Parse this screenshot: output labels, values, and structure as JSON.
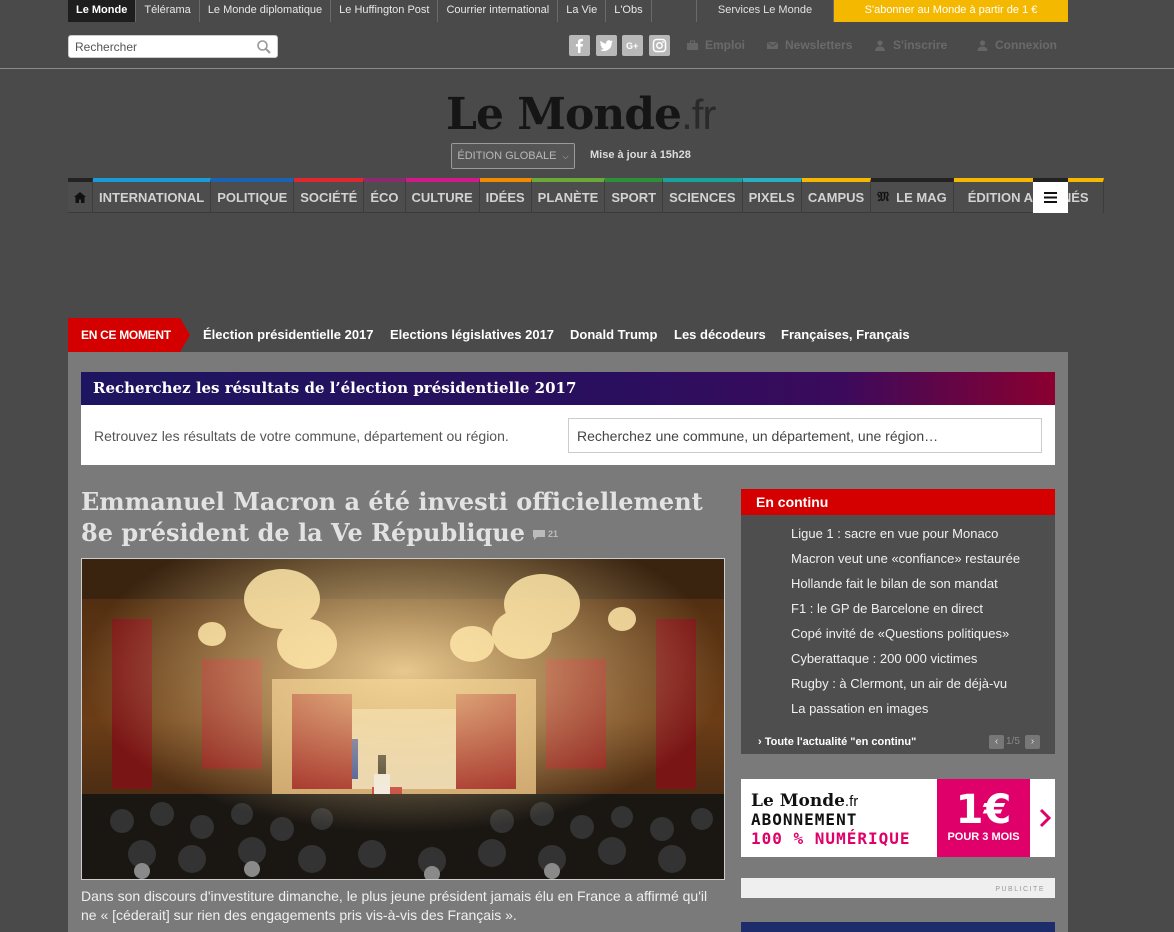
{
  "topbar": {
    "sites": [
      "Le Monde",
      "Télérama",
      "Le Monde diplomatique",
      "Le Huffington Post",
      "Courrier international",
      "La Vie",
      "L'Obs"
    ],
    "services": "Services Le Monde",
    "subscribe": "S'abonner au Monde à partir de 1 €"
  },
  "search": {
    "placeholder": "Rechercher"
  },
  "utility": {
    "emploi": "Emploi",
    "newsletters": "Newsletters",
    "inscrire": "S'inscrire",
    "connexion": "Connexion"
  },
  "logo": {
    "name": "Le Monde",
    "suffix": ".fr"
  },
  "edition": {
    "label": "ÉDITION GLOBALE",
    "updated": "Mise à jour à 15h28"
  },
  "nav": {
    "items": [
      {
        "label": "INTERNATIONAL",
        "color": "#1a9ad6"
      },
      {
        "label": "POLITIQUE",
        "color": "#1a63b4"
      },
      {
        "label": "SOCIÉTÉ",
        "color": "#e0262f"
      },
      {
        "label": "ÉCO",
        "color": "#8a2a6f"
      },
      {
        "label": "CULTURE",
        "color": "#d1198a"
      },
      {
        "label": "IDÉES",
        "color": "#f08a00"
      },
      {
        "label": "PLANÈTE",
        "color": "#6aa83a"
      },
      {
        "label": "SPORT",
        "color": "#2d8f3a"
      },
      {
        "label": "SCIENCES",
        "color": "#17a2a0"
      },
      {
        "label": "PIXELS",
        "color": "#26b0c4"
      },
      {
        "label": "CAMPUS",
        "color": "#f5b800"
      },
      {
        "label": "LE MAG",
        "color": "#222222"
      },
      {
        "label": "ÉDITION ABONNÉS",
        "color": "#f5b800"
      }
    ]
  },
  "moment": {
    "badge": "EN CE MOMENT",
    "links": [
      "Élection présidentielle 2017",
      "Elections législatives 2017",
      "Donald Trump",
      "Les décodeurs",
      "Françaises, Français"
    ]
  },
  "election": {
    "title": "Recherchez les résultats de l’élection présidentielle 2017",
    "description": "Retrouvez les résultats de votre commune, département ou région.",
    "placeholder": "Recherchez une commune, un département, une région…"
  },
  "article": {
    "headline": "Emmanuel Macron a été investi officiellement 8e président de la Ve République",
    "comment_count": "21",
    "caption": "Dans son discours d'investiture dimanche, le plus jeune président jamais élu en France a affirmé qu'il ne « [céderait] sur rien des engagements pris vis-à-vis des Français »."
  },
  "continu": {
    "header": "En continu",
    "items": [
      "Ligue 1 : sacre en vue pour Monaco",
      "Macron veut une «confiance» restaurée",
      "Hollande fait le bilan de son mandat",
      "F1 : le GP de Barcelone en direct",
      "Copé invité de «Questions politiques»",
      "Cyberattaque : 200 000 victimes",
      "Rugby : à Clermont, un air de déjà-vu",
      "La passation en images"
    ],
    "all_link": "› Toute l'actualité \"en continu\"",
    "pager": "1/5"
  },
  "ad": {
    "logo": "Le Monde",
    "suffix": ".fr",
    "line1": "ABONNEMENT",
    "line2": "100 % NUMÉRIQUE",
    "price": "1€",
    "months": "POUR 3 MOIS",
    "publicite": "PUBLICITE"
  },
  "colors": {
    "accent_red": "#d40000",
    "brand_pink": "#e0006a",
    "subscribe_yellow": "#f5b800"
  }
}
